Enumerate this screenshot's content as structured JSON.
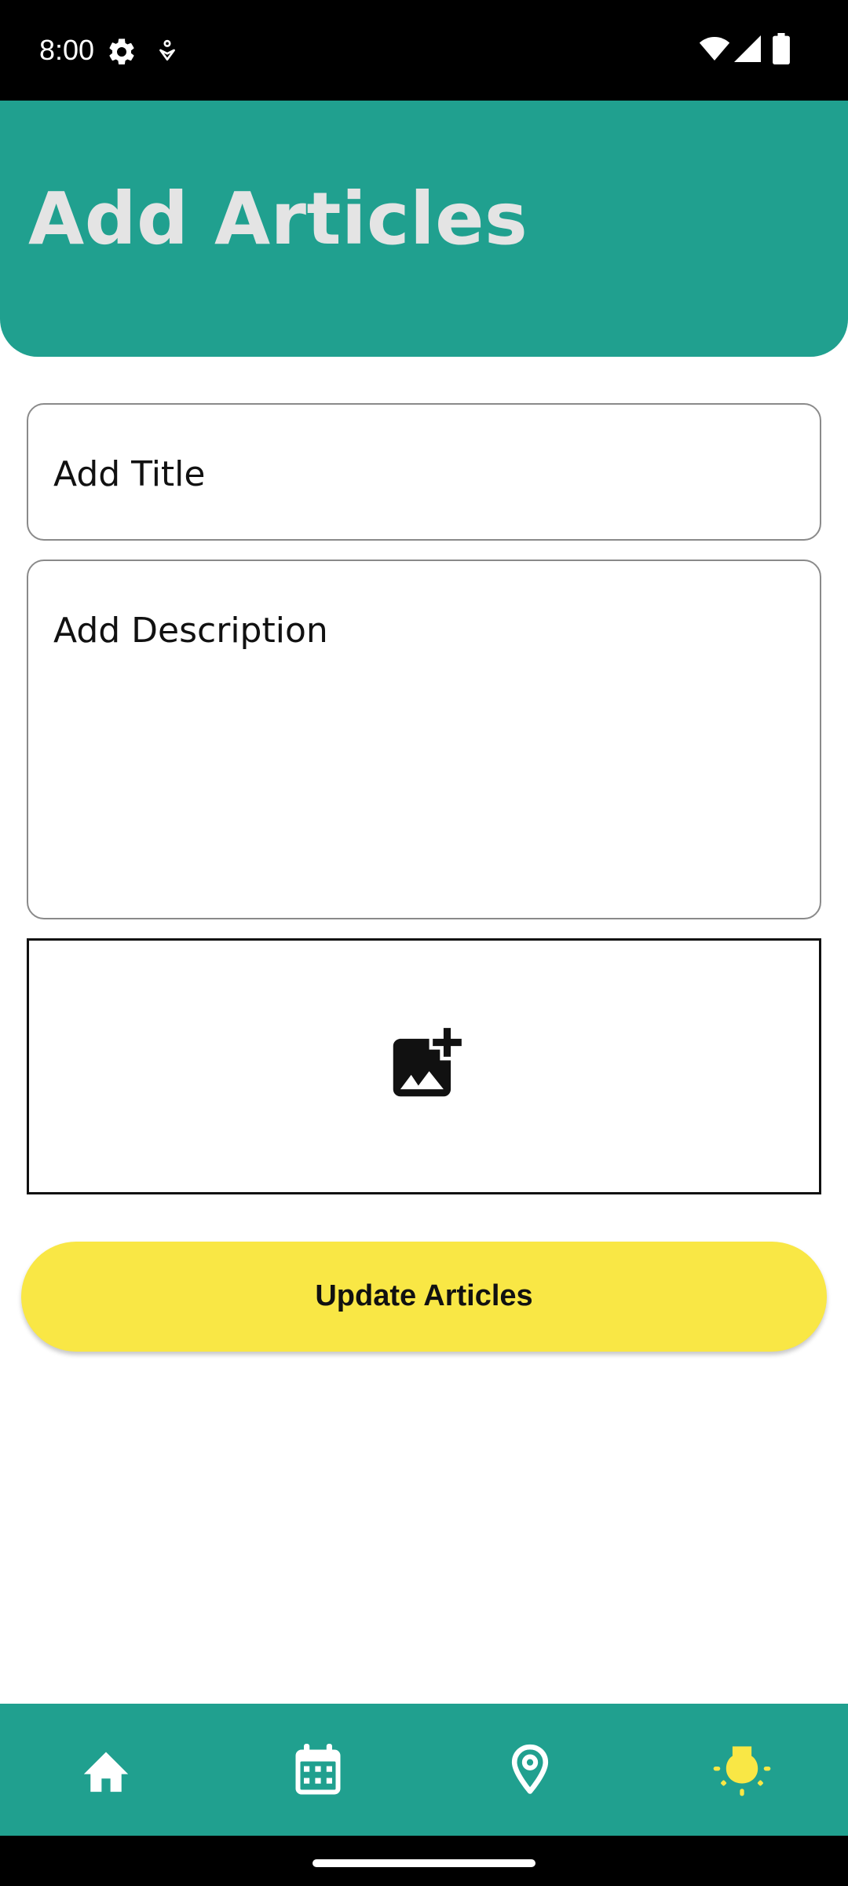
{
  "status_bar": {
    "time": "8:00",
    "icons": [
      "settings-gear-icon",
      "accessibility-icon",
      "wifi-icon",
      "signal-icon",
      "battery-icon"
    ]
  },
  "header": {
    "title": "Add Articles",
    "background_color": "#20a08f",
    "title_color": "#e4e4e4"
  },
  "form": {
    "title_placeholder": "Add Title",
    "description_placeholder": "Add Description",
    "image_picker_icon": "add-photo-icon"
  },
  "action": {
    "button_label": "Update Articles",
    "button_color": "#f9e745"
  },
  "bottom_nav": {
    "items": [
      {
        "icon": "home-icon",
        "active": false
      },
      {
        "icon": "calendar-icon",
        "active": false
      },
      {
        "icon": "location-pin-icon",
        "active": false
      },
      {
        "icon": "lightbulb-icon",
        "active": true
      }
    ],
    "active_color": "#f9e745",
    "inactive_color": "#ffffff"
  }
}
